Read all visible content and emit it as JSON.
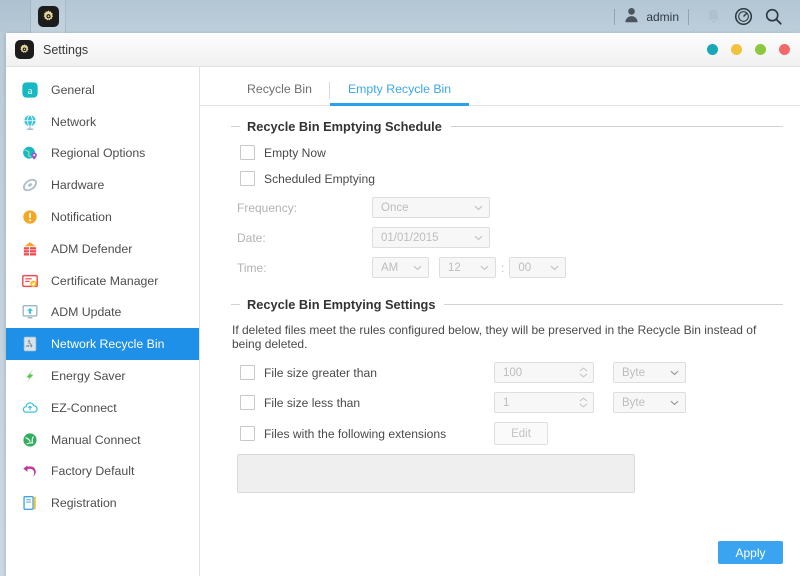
{
  "desktop": {
    "app_launcher_icon": "gear-icon",
    "user_icon": "user-avatar-icon",
    "user_name": "admin",
    "bell_icon": "notification-bell-icon",
    "monitor_icon": "system-monitor-icon",
    "search_icon": "search-icon"
  },
  "window": {
    "title": "Settings",
    "title_icon": "gear-icon",
    "controls": [
      {
        "name": "minimize-dot",
        "color": "#16a7b8"
      },
      {
        "name": "restore-dot",
        "color": "#f1c33c"
      },
      {
        "name": "maximize-dot",
        "color": "#8dc63f"
      },
      {
        "name": "close-dot",
        "color": "#f2696b"
      }
    ]
  },
  "sidebar": {
    "items": [
      {
        "label": "General",
        "icon": "general-icon"
      },
      {
        "label": "Network",
        "icon": "globe-icon"
      },
      {
        "label": "Regional Options",
        "icon": "regional-options-icon"
      },
      {
        "label": "Hardware",
        "icon": "hardware-icon"
      },
      {
        "label": "Notification",
        "icon": "notification-icon"
      },
      {
        "label": "ADM Defender",
        "icon": "firewall-icon"
      },
      {
        "label": "Certificate Manager",
        "icon": "certificate-icon"
      },
      {
        "label": "ADM Update",
        "icon": "update-icon"
      },
      {
        "label": "Network Recycle Bin",
        "icon": "recycle-bin-icon",
        "active": true
      },
      {
        "label": "Energy Saver",
        "icon": "energy-saver-icon"
      },
      {
        "label": "EZ-Connect",
        "icon": "cloud-connect-icon"
      },
      {
        "label": "Manual Connect",
        "icon": "manual-connect-icon"
      },
      {
        "label": "Factory Default",
        "icon": "factory-default-icon"
      },
      {
        "label": "Registration",
        "icon": "registration-icon"
      }
    ]
  },
  "tabs": [
    {
      "label": "Recycle Bin",
      "active": false
    },
    {
      "label": "Empty Recycle Bin",
      "active": true
    }
  ],
  "schedule_section": {
    "title": "Recycle Bin Emptying Schedule",
    "empty_now": {
      "label": "Empty Now",
      "checked": false
    },
    "scheduled_emptying": {
      "label": "Scheduled Emptying",
      "checked": false
    },
    "frequency": {
      "label": "Frequency:",
      "value": "Once",
      "disabled": true
    },
    "date": {
      "label": "Date:",
      "value": "01/01/2015",
      "disabled": true
    },
    "time": {
      "label": "Time:",
      "ampm": "AM",
      "hour": "12",
      "separator": ":",
      "minute": "00",
      "disabled": true
    }
  },
  "settings_section": {
    "title": "Recycle Bin Emptying Settings",
    "description": "If deleted files meet the rules configured below, they will be preserved in the Recycle Bin instead of being deleted.",
    "rules": [
      {
        "label": "File size greater than",
        "checked": false,
        "value": "100",
        "unit": "Byte",
        "disabled": true
      },
      {
        "label": "File size less than",
        "checked": false,
        "value": "1",
        "unit": "Byte",
        "disabled": true
      }
    ],
    "extensions_rule": {
      "label": "Files with the following extensions",
      "checked": false,
      "edit_label": "Edit",
      "textarea_value": "",
      "disabled": true
    }
  },
  "footer": {
    "apply_label": "Apply"
  },
  "colors": {
    "accent_blue": "#3ba4f0",
    "tab_active": "#29a3e8",
    "sidebar_active": "#1e90e8",
    "desktop_bg": "#bdcedb"
  }
}
